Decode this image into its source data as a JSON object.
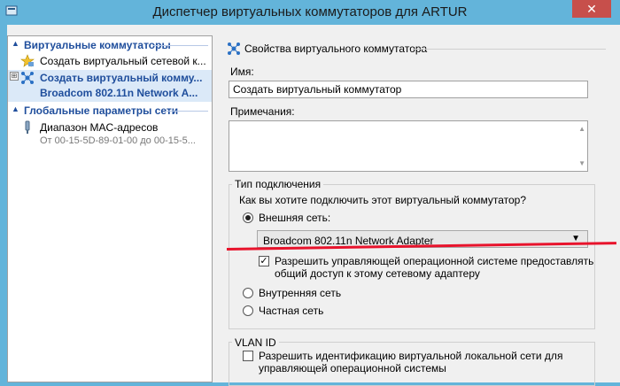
{
  "window": {
    "title": "Диспетчер виртуальных коммутаторов для ARTUR",
    "close_glyph": "✕"
  },
  "left_pane": {
    "section_switches": "Виртуальные коммутаторы",
    "create_item": "Создать виртуальный сетевой к...",
    "selected_item_line1": "Создать виртуальный комму...",
    "selected_item_line2": "Broadcom 802.11n Network A...",
    "section_global": "Глобальные параметры сети",
    "mac_item_title": "Диапазон MAC-адресов",
    "mac_item_sub": "От 00-15-5D-89-01-00 до 00-15-5...",
    "expander_glyph": "⊞"
  },
  "right_pane": {
    "header": "Свойства виртуального коммутатора",
    "name_label": "Имя:",
    "name_value": "Создать виртуальный коммутатор",
    "notes_label": "Примечания:",
    "connection_group": "Тип подключения",
    "connection_question": "Как вы хотите подключить этот виртуальный коммутатор?",
    "external_label": "Внешняя сеть:",
    "adapter_selected": "Broadcom 802.11n Network Adapter",
    "share_line1": "Разрешить управляющей операционной системе предоставлять",
    "share_line2": "общий доступ к этому сетевому адаптеру",
    "internal_label": "Внутренняя сеть",
    "private_label": "Частная сеть",
    "vlan_group": "VLAN ID",
    "vlan_line1": "Разрешить идентификацию виртуальной локальной сети для",
    "vlan_line2": "управляющей операционной системы"
  },
  "state": {
    "connection_type": "external",
    "share_checked": true,
    "vlan_checked": false
  },
  "colors": {
    "titlebar": "#63b4da",
    "accent_text": "#1f4e9c",
    "annotation_red": "#e8132c"
  }
}
